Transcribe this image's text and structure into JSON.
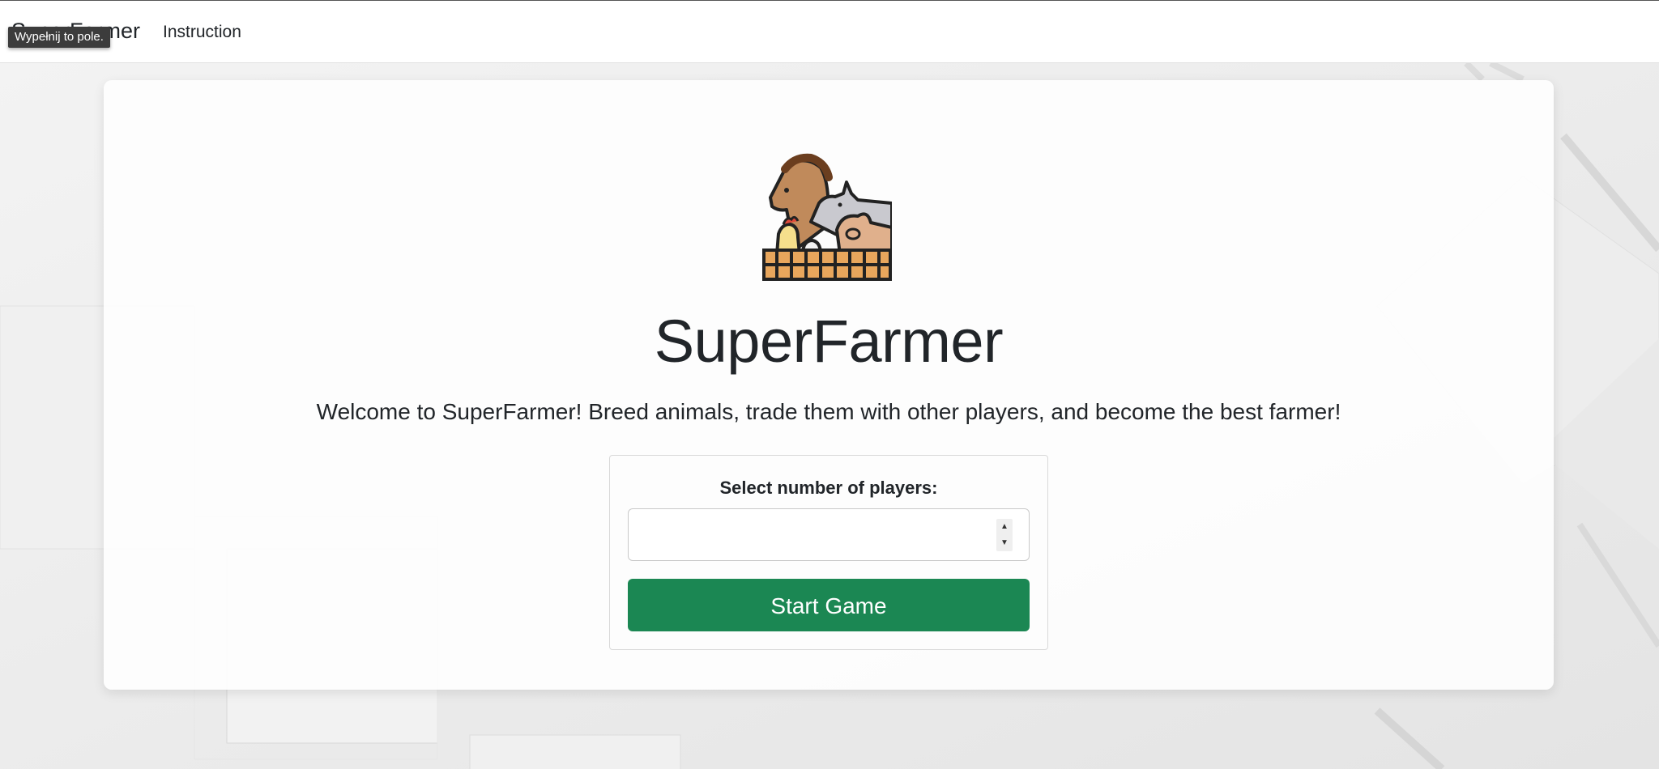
{
  "navbar": {
    "brand": "SuperFarmer",
    "links": [
      {
        "label": "Instruction"
      }
    ]
  },
  "tooltip": {
    "text": "Wypełnij to pole."
  },
  "main": {
    "title": "SuperFarmer",
    "welcome": "Welcome to SuperFarmer! Breed animals, trade them with other players, and become the best farmer!",
    "logo_icon": "farm-animals-icon",
    "form": {
      "label": "Select number of players:",
      "players_input": {
        "value": "",
        "placeholder": ""
      },
      "start_button": "Start Game"
    }
  },
  "colors": {
    "accent_green": "#1b8753",
    "tooltip_bg": "#3c3c3c",
    "page_bg": "#ececec"
  }
}
